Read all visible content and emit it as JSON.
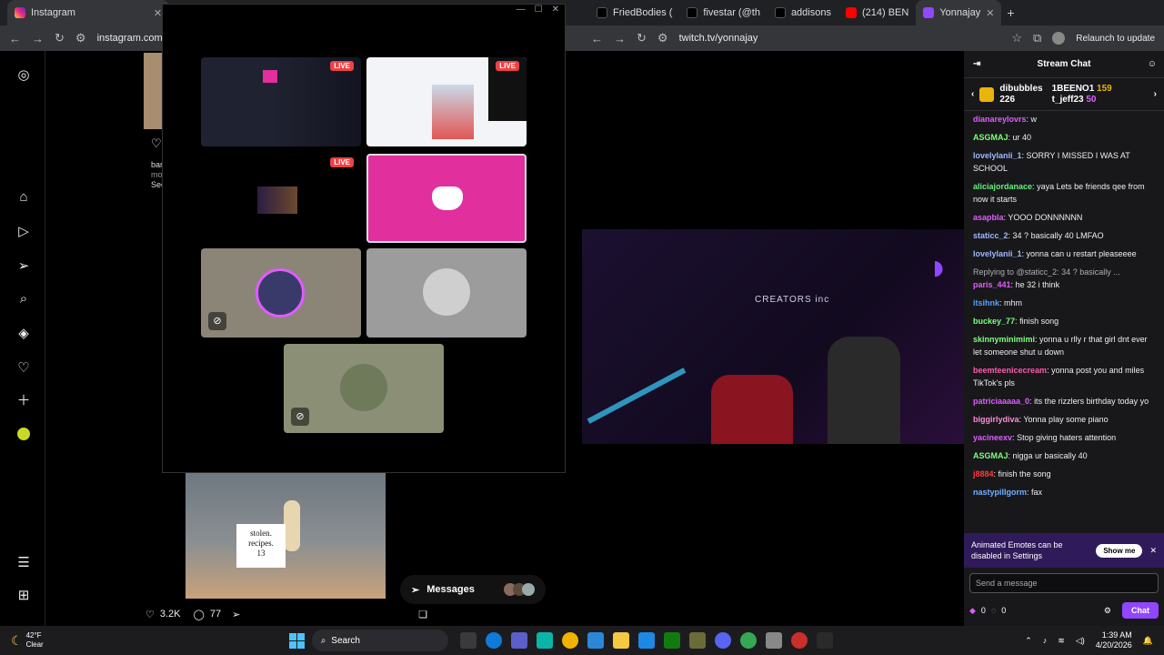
{
  "instagram_window": {
    "tab_title": "Instagram",
    "url": "instagram.com",
    "post_caption_line1": "bar",
    "post_caption_line2": "mo",
    "post_caption_line3": "See",
    "likes": "3.2K",
    "comments": "77",
    "label_line1": "stolen.",
    "label_line2": "recipes.",
    "label_line3": "13",
    "messages_label": "Messages"
  },
  "discord_overlay": {
    "tiles": [
      {
        "live": "LIVE"
      },
      {
        "live": "LIVE"
      },
      {
        "live": "LIVE"
      }
    ],
    "discord_tile_color": "#e12f9e"
  },
  "twitch_window": {
    "tabs": [
      "FriedBodies (",
      "fivestar (@th",
      "addisons",
      "(214) BEN",
      "Yonnajay"
    ],
    "url": "twitch.tv/yonnajay",
    "relaunch": "Relaunch to update",
    "stream_overlay_text": "CREATORS inc",
    "chat": {
      "title": "Stream Chat",
      "gift_user": "dibubbles",
      "gift_user_count": "226",
      "top_gifters": [
        {
          "name": "1BEENO1",
          "count": "159"
        },
        {
          "name": "t_jeff23",
          "count": "50"
        }
      ],
      "messages": [
        {
          "user": "dianareylovrs",
          "color": "#e05cff",
          "text": "w"
        },
        {
          "user": "ASGMAJ",
          "color": "#7cff7c",
          "text": "ur 40"
        },
        {
          "user": "lovelylanii_1",
          "color": "#9fb7ff",
          "text": "SORRY I MISSED I WAS AT SCHOOL"
        },
        {
          "user": "aliciajordanace",
          "color": "#63f27b",
          "text": "yaya Lets be friends qee from now it starts"
        },
        {
          "user": "asapbla",
          "color": "#e05cff",
          "text": "YOOO DONNNNNN"
        },
        {
          "user": "staticc_2",
          "color": "#9fb7ff",
          "text": "34 ? basically 40 LMFAO"
        },
        {
          "user": "lovelylanii_1",
          "color": "#9fb7ff",
          "text": "yonna can u restart pleaseeee"
        },
        {
          "user": "paris_441",
          "color": "#e05cff",
          "text": "he 32 i think",
          "reply": "Replying to @staticc_2: 34 ? basically ..."
        },
        {
          "user": "itsihnk",
          "color": "#4ea4ff",
          "text": "mhm"
        },
        {
          "user": "buckey_77",
          "color": "#7cff7c",
          "text": "finish song"
        },
        {
          "user": "skinnyminimimi",
          "color": "#7cff7c",
          "text": "yonna u rlly r that girl dnt ever let someone shut u down"
        },
        {
          "user": "beemteenicecream",
          "color": "#ff5cb0",
          "text": "yonna post you and miles TikTok's pls"
        },
        {
          "user": "patriciaaaaa_0",
          "color": "#e05cff",
          "text": "its the rizzlers birthday today yo"
        },
        {
          "user": "biggirlydiva",
          "color": "#ff8ad8",
          "text": "Yonna play some piano"
        },
        {
          "user": "yacineexv",
          "color": "#e05cff",
          "text": "Stop giving haters attention"
        },
        {
          "user": "ASGMAJ",
          "color": "#7cff7c",
          "text": "nigga ur basically 40"
        },
        {
          "user": "j8884",
          "color": "#ff3b3b",
          "text": "finish the song"
        },
        {
          "user": "nastypillgorm",
          "color": "#6fb1ff",
          "text": "fax"
        }
      ],
      "promo_text": "Animated Emotes can be disabled in Settings",
      "promo_button": "Show me",
      "input_placeholder": "Send a message",
      "points_a": "0",
      "points_b": "0",
      "chat_button": "Chat"
    }
  },
  "taskbar": {
    "weather_temp": "42°F",
    "weather_desc": "Clear",
    "search_label": "Search",
    "time": "1:39 AM",
    "date": "4/20/2026"
  }
}
